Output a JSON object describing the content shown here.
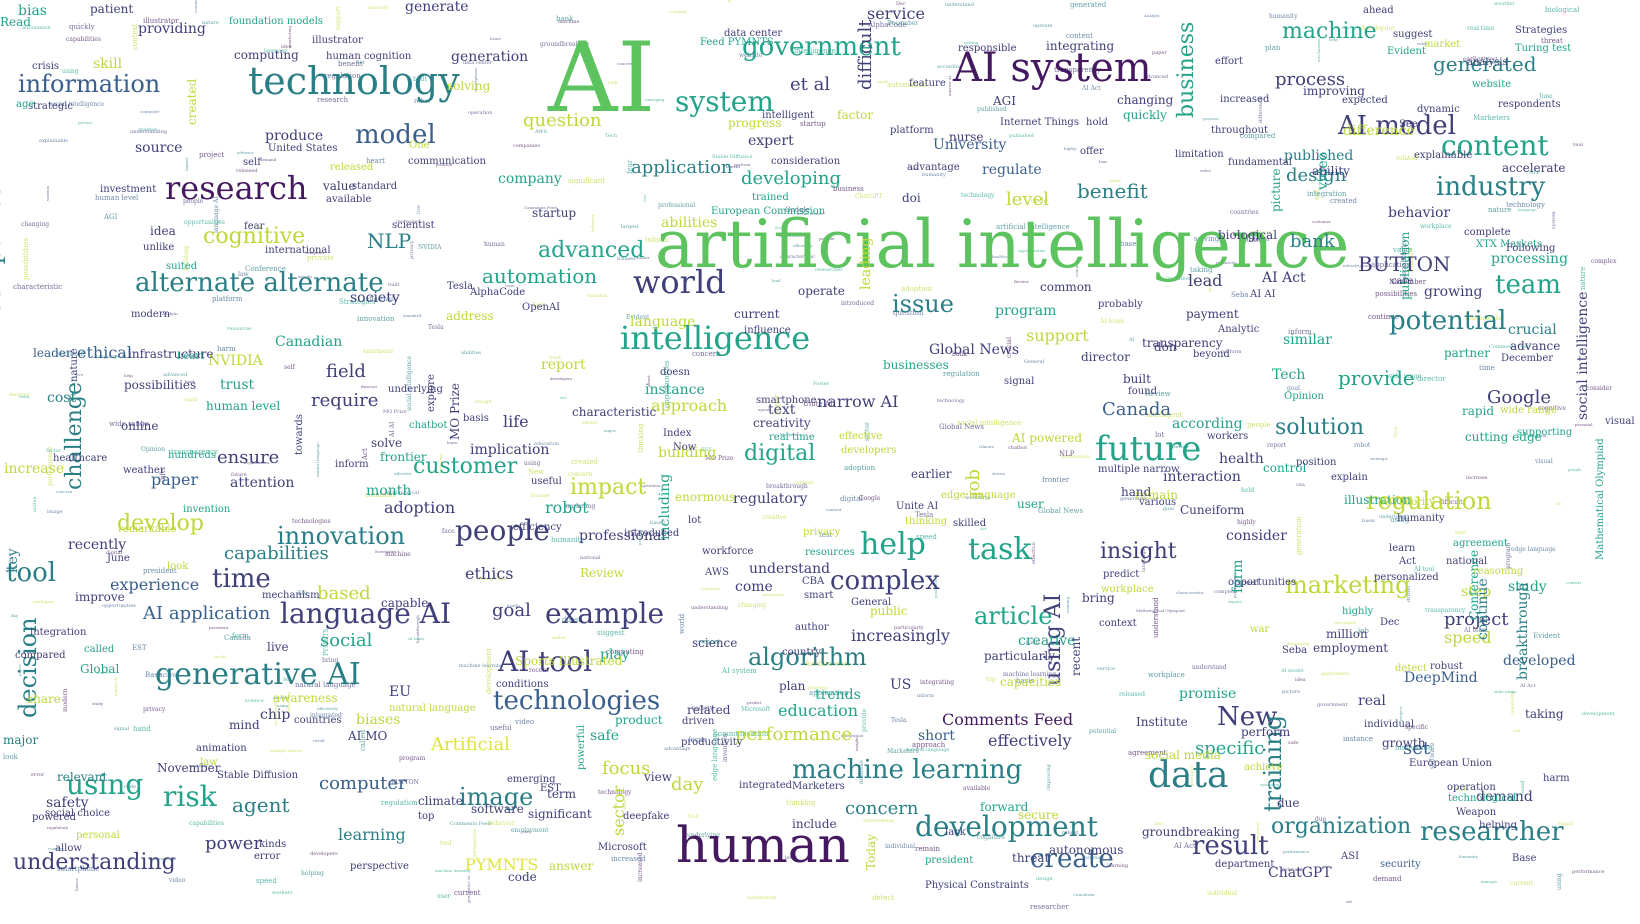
{
  "palette": {
    "dark_purple": "#44195f",
    "purple": "#3f3f7a",
    "blue": "#3a5f8c",
    "teal": "#2a7f86",
    "teal_green": "#22a38a",
    "green": "#5cc35f",
    "yellow_green": "#bcd93a",
    "yellow": "#dfe33a"
  },
  "words": {
    "w_ai": "AI",
    "w_artificial_intelligence": "artificial intelligence",
    "w_human": "human",
    "w_technology": "technology",
    "w_ai_system": "AI system",
    "w_research": "research",
    "w_intelligence": "intelligence",
    "w_world": "world",
    "w_generative_ai": "generative AI",
    "w_future": "future",
    "w_data": "data",
    "w_development": "development",
    "w_machine_learning": "machine learning",
    "w_language_ai": "language AI",
    "w_ai_tool": "AI tool",
    "w_technologies": "technologies",
    "w_example": "example",
    "w_people": "people",
    "w_help": "help",
    "w_task": "task",
    "w_complex": "complex",
    "w_system": "system",
    "w_government": "government",
    "w_model": "model",
    "w_information": "information",
    "w_alternate_alternate": "alternate alternate",
    "w_ai_model": "AI model",
    "w_content": "content",
    "w_industry": "industry",
    "w_potential": "potential",
    "w_team": "team",
    "w_researcher": "researcher",
    "w_create": "create",
    "w_organization": "organization",
    "w_article": "article",
    "w_algorithm": "algorithm",
    "w_marketing": "marketing",
    "w_regulation": "regulation",
    "w_solution": "solution",
    "w_insight": "insight",
    "w_new": "New",
    "w_result": "result",
    "w_understanding": "understanding",
    "w_risk": "risk",
    "w_image": "image",
    "w_using": "using",
    "w_tool": "tool",
    "w_time": "time",
    "w_innovation": "innovation",
    "w_develop": "develop",
    "w_customer": "customer",
    "w_impact": "impact",
    "w_digital": "digital",
    "w_advanced": "advanced",
    "w_automation": "automation",
    "w_issue": "issue",
    "w_cognitive": "cognitive",
    "w_nlp": "NLP",
    "w_question": "question",
    "w_application": "application",
    "w_developing": "developing",
    "w_benefit": "benefit",
    "w_process": "process",
    "w_generated": "generated",
    "w_machine": "machine",
    "w_design": "design",
    "w_bank": "bank",
    "w_button": "BUTTON",
    "w_provide": "provide",
    "w_google": "Google",
    "w_canada": "Canada",
    "w_computer": "computer",
    "w_agent": "agent",
    "w_concern": "concern",
    "w_education": "education",
    "w_performance": "performance",
    "w_comments_feed": "Comments Feed",
    "w_effectively": "effectively",
    "w_specific": "specific",
    "w_set": "set",
    "w_project": "project",
    "w_speed": "speed",
    "w_capabilities": "capabilities",
    "w_experience": "experience",
    "w_ai_application": "AI application",
    "w_paper": "paper",
    "w_ensure": "ensure",
    "w_require": "require",
    "w_field": "field",
    "w_adoption": "adoption",
    "w_robot": "robot",
    "w_goal": "goal",
    "w_ethics": "ethics",
    "w_social": "social",
    "w_based": "based",
    "w_increasingly": "increasingly",
    "w_approach": "approach",
    "w_narrow_ai": "narrow AI",
    "w_support": "support",
    "w_program": "program",
    "w_level": "level",
    "w_et_al": "et al",
    "w_service": "service",
    "w_university": "University",
    "w_regulate": "regulate",
    "w_expert": "expert",
    "w_progress": "progress",
    "w_difficult": "difficult",
    "w_published": "published",
    "w_difference": "difference",
    "w_accelerate": "accelerate",
    "w_behavior": "behavior",
    "w_processing": "processing",
    "w_growing": "growing",
    "w_crucial": "crucial",
    "w_advance": "advance",
    "w_according": "according",
    "w_cutting_edge": "cutting edge",
    "w_health": "health",
    "w_interaction": "interaction",
    "w_consider": "consider",
    "w_study": "study",
    "w_step": "step",
    "w_employment": "employment",
    "w_developed": "developed",
    "w_deepmind": "DeepMind",
    "w_real": "real",
    "w_growth": "growth",
    "w_demand": "demand",
    "w_promise": "promise",
    "w_taking": "taking",
    "w_companies": "companies",
    "w_challenge": "challenge",
    "w_decision": "decision",
    "w_business": "business",
    "w_training": "training",
    "w_using_ai": "using AI",
    "w_job": "job",
    "w_sector": "sector",
    "w_focus": "focus",
    "w_day": "day",
    "w_power": "power",
    "w_learning": "learning",
    "w_pymnts": "PYMNTS",
    "w_answer": "answer",
    "w_significant": "significant",
    "w_chatgpt": "ChatGPT",
    "w_security": "security",
    "w_biases": "biases",
    "w_artificial": "Artificial",
    "w_safety": "safety",
    "w_major": "major",
    "w_recently": "recently",
    "w_ethical": "ethical",
    "w_leader": "leader",
    "w_cost": "cost",
    "w_increase": "increase",
    "w_source": "source",
    "w_produce": "produce",
    "w_computing": "computing",
    "w_providing": "providing",
    "w_skill": "skill",
    "w_bias": "bias",
    "w_patient": "patient",
    "w_generate": "generate",
    "w_generation": "generation",
    "w_solving": "solving",
    "w_foundation_models": "foundation models",
    "w_agi": "AGI",
    "w_integrating": "integrating",
    "w_improving": "improving",
    "w_suggest": "suggest",
    "w_turing_test": "Turing test",
    "w_company": "company",
    "w_startup": "startup",
    "w_scientist": "scientist",
    "w_society": "society",
    "w_canadian": "Canadian",
    "w_nvidia": "NVIDIA",
    "w_trust": "trust",
    "w_human_level": "human level",
    "w_attention": "attention",
    "w_month": "month",
    "w_life": "life",
    "w_implication": "implication",
    "w_building": "building",
    "w_text": "text",
    "w_creativity": "creativity",
    "w_regulatory": "regulatory",
    "w_understand": "understand",
    "w_come": "come",
    "w_trends": "trends",
    "w_plan": "plan",
    "w_related": "related",
    "w_safe": "safe",
    "w_product": "product",
    "w_play": "play",
    "w_review": "Review",
    "w_professional": "professional",
    "w_including": "including",
    "w_public": "public",
    "w_creative": "creative",
    "w_particularly": "particularly",
    "w_capacities": "capacities",
    "w_us": "US",
    "w_short": "short",
    "w_forward": "forward",
    "w_secure": "secure",
    "w_threat": "threat",
    "w_autonomous": "autonomous",
    "w_eu": "EU",
    "w_chip": "chip",
    "w_awareness": "awareness",
    "w_mind": "mind",
    "w_live": "live",
    "w_ai_mo": "AI MO",
    "w_global": "Global",
    "w_global_news": "Global News",
    "w_director": "director",
    "w_transparency": "transparency",
    "w_lead": "lead",
    "w_payment": "payment",
    "w_similar": "similar",
    "w_tech": "Tech",
    "w_ai_act": "AI Act",
    "w_ai_powered": "AI powered",
    "w_user": "user",
    "w_remain": "remain",
    "w_humanity": "humanity",
    "w_control": "control",
    "w_multiple_narrow": "multiple narrow",
    "w_predict": "predict",
    "w_europe_union": "European Union",
    "w_opportunities": "opportunities",
    "w_national": "national",
    "w_learn": "learn",
    "w_visual": "visual",
    "w_social_intelligence": "social intelligence",
    "w_breakthrough": "breakthrough",
    "w_continue": "continue",
    "w_conference": "Conference",
    "w_publication": "publication",
    "w_video": "video",
    "w_picture": "picture",
    "w_biological": "biological",
    "w_operate": "operate",
    "w_current": "current",
    "w_language": "language",
    "w_address": "address",
    "w_instance": "instance",
    "w_leading": "leading",
    "w_report": "report",
    "w_characteristic": "characteristic",
    "w_solve": "solve",
    "w_frontier": "frontier",
    "w_chatbot": "chatbot",
    "w_basis": "basis",
    "w_enormous": "enormous",
    "w_introduced": "introduced",
    "w_sports_illustrated": "Sports Illustrated",
    "w_science": "science",
    "w_social_media": "social media",
    "w_institute": "Institute",
    "w_groundbreaking": "groundbreaking",
    "w_nurse": "nurse",
    "w_large_label": "large",
    "w_read": "Read",
    "w_idea": "idea",
    "w_unlike": "unlike",
    "w_international": "international",
    "w_infrastructure": "infrastructure",
    "w_possibilities": "possibilities",
    "w_online": "online",
    "w_remarkable": "remarkable",
    "w_improve": "improve",
    "w_capable": "capable",
    "w_underlying": "underlying",
    "w_efficiency": "efficiency",
    "w_explain": "explain",
    "w_illustration": "illustration",
    "w_position": "position",
    "w_agreement": "agreement",
    "w_reasoning": "reasoning",
    "w_million": "million",
    "w_partner": "partner",
    "w_rapid": "rapid",
    "w_supporting": "supporting",
    "w_complete": "complete",
    "w_strategies": "Strategies",
    "w_analysis": "analysis",
    "w_evident": "Evident",
    "w_market": "market",
    "w_ahead": "ahead",
    "w_key": "key",
    "w_relevant": "relevant",
    "w_november": "November",
    "w_stable_diffusion": "Stable Diffusion",
    "w_emerging": "emerging",
    "w_software": "software",
    "w_code": "code",
    "w_perspective": "perspective",
    "w_view": "view",
    "w_include": "include",
    "w_integrated": "integrated",
    "w_marketers": "Marketers",
    "w_physical_constraints": "Physical Constraints",
    "w_president": "president",
    "w_today": "Today",
    "w_recent": "recent",
    "w_perform": "perform",
    "w_personal": "personal",
    "w_allow": "allow",
    "w_powered": "powered",
    "w_social_choice": "social choice",
    "w_called": "called",
    "w_integration": "integration",
    "w_compared": "compared",
    "w_sharing": "share",
    "w_sports": "form",
    "w_cuneiform": "Cuneiform",
    "w_workers": "workers",
    "w_conditions": "conditions",
    "w_natural_language": "natural language",
    "w_productivity": "productivity",
    "w_fundamental": "fundamental",
    "w_changing": "changing",
    "w_responsible": "responsible",
    "w_modern": "modern",
    "w_created": "created",
    "w_strategic": "strategic",
    "w_united_states": "United States",
    "w_standard": "standard",
    "w_value": "value",
    "w_available": "available",
    "w_released": "released",
    "w_investment": "investment",
    "w_limitation": "limitation",
    "w_quickly": "quickly",
    "w_ability": "ability",
    "w_alphacode": "AlphaCode",
    "w_openai": "OpenAI",
    "w_tesla": "Tesla",
    "w_abilities": "abilities",
    "w_trained": "trained",
    "w_doi": "doi",
    "w_factor": "factor",
    "w_advantage": "advantage",
    "w_influence": "influence",
    "w_common": "common",
    "w_probably": "probably",
    "w_built": "built",
    "w_found": "found",
    "w_signal": "signal",
    "w_don": "don",
    "w_beyond": "beyond",
    "w_analytic": "Analytic",
    "w_december": "December",
    "w_earlier": "earlier",
    "w_unite_ai": "Unite AI",
    "w_edge_language": "edge language",
    "w_general": "General",
    "w_author": "author",
    "w_skilled": "skilled",
    "w_achieve": "achieve",
    "w_operation": "operation",
    "w_technological": "technological",
    "w_weapon": "Weapon",
    "w_helping": "helping",
    "w_harm": "harm",
    "w_care": "care",
    "w_hand": "hand",
    "w_various": "various",
    "w_bring": "bring",
    "w_context": "context",
    "w_robust": "robust",
    "w_detect": "detect",
    "w_face": "face",
    "w_war": "war",
    "w_due": "due",
    "w_seba": "Seba",
    "w_largest": "largest",
    "w_workplace": "workplace",
    "w_highly": "highly",
    "w_personalized": "personalized",
    "w_keys": "Act",
    "w_dec": "Dec",
    "w_june": "June",
    "w_fostered": "Foster",
    "w_invention": "invention",
    "w_hundreds": "hundreds",
    "w_inform": "inform",
    "w_now": "Now",
    "w_doesn": "doesn",
    "w_smartphone": "smartphone",
    "w_real_time": "real time",
    "w_effective": "effective",
    "w_developers": "developers",
    "w_businesses": "businesses",
    "w_resources": "resources",
    "w_privacy": "privacy",
    "w_thinking": "thinking",
    "w_index": "Index",
    "w_lot": "lot",
    "w_workforce": "workforce",
    "w_ibm": "AWS",
    "w_country": "country",
    "w_feature": "feature",
    "w_one": "One",
    "w_communication": "communication",
    "w_self": "self",
    "w_illustrator": "illustrator",
    "w_human_cognition": "human cognition",
    "w_data_center": "data center",
    "w_feed_pymnts": "Feed PYMNTS",
    "w_intelligent": "intelligent",
    "w_consideration": "consideration",
    "w_european_commission": "European Commission",
    "w_platform": "platform",
    "w_internet_things": "Internet Things",
    "w_hold": "hold",
    "w_offer": "offer",
    "w_throughout": "throughout",
    "w_effort": "effort",
    "w_increased": "increased",
    "w_expected": "expected",
    "w_respondents": "respondents",
    "w_dynamic": "dynamic",
    "w_explainable": "explainable",
    "w_website": "website",
    "w_see": "See",
    "w_xtx_markets": "XTX Markets",
    "w_following": "Following",
    "w_wide_range": "wide range",
    "w_opinion": "Opinion",
    "w_ai_ai": "AI AI",
    "w_aitheority": "AITheority",
    "w_mathematical_olympiad": "Mathematical Olympiad",
    "w_asi": "ASI",
    "w_base": "Base",
    "w_center": "center",
    "w_cutting_edge_2": "growth",
    "w_individual": "individual",
    "w_healthcare": "healthcare",
    "w_weather": "weather",
    "w_crisis": "crisis",
    "w_age": "age",
    "w_fear": "fear",
    "w_suited": "suited",
    "w_explore": "explore",
    "w_towards": "towards",
    "w_mo_prize": "MO Prize",
    "w_useful": "useful",
    "w_driven": "driven",
    "w_term": "term",
    "w_powerful": "powerful",
    "w_est": "EST",
    "w_deepfake": "deepfake",
    "w_microsoft": "Microsoft",
    "w_lack": "lack",
    "w_manage": "manage",
    "w_nature": "nature",
    "w_heart": "heart",
    "w_look": "look",
    "w_mechanism": "mechanism",
    "w_countries": "countries",
    "w_animation": "animation",
    "w_law": "law",
    "w_error": "error",
    "w_kinds": "kinds",
    "w_climate": "climate",
    "w_top": "top",
    "w_ai_team": "AI team",
    "w_department": "department",
    "w_test": "test",
    "w_cba": "CBA",
    "w_matter": "matter",
    "w_smart": "smart"
  }
}
